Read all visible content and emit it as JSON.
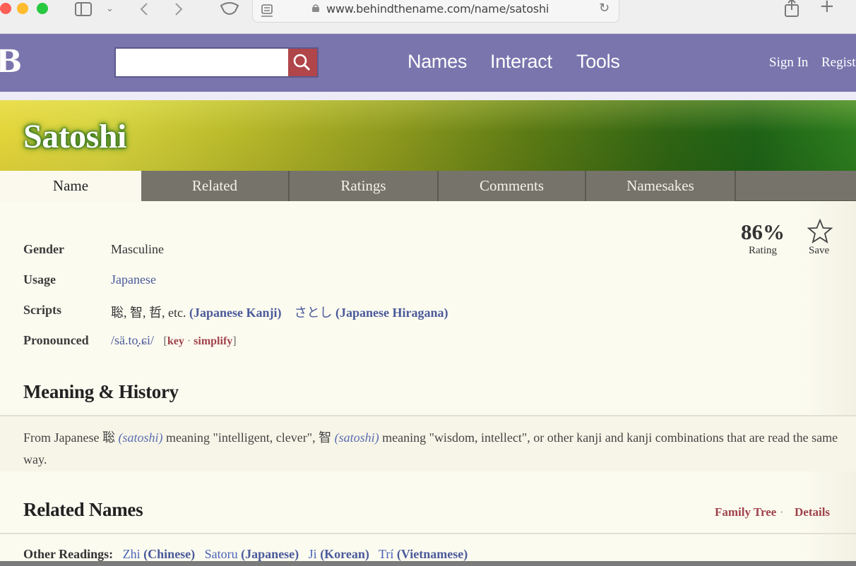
{
  "browser": {
    "url": "www.behindthename.com/name/satoshi"
  },
  "header": {
    "logo": "B",
    "search_placeholder": "",
    "nav": [
      "Names",
      "Interact",
      "Tools"
    ],
    "sign_in": "Sign In",
    "register": "Regist"
  },
  "page": {
    "title": "Satoshi",
    "tabs": [
      "Name",
      "Related",
      "Ratings",
      "Comments",
      "Namesakes"
    ],
    "active_tab": "Name"
  },
  "info": {
    "gender_label": "Gender",
    "gender_value": "Masculine",
    "usage_label": "Usage",
    "usage_value": "Japanese",
    "scripts_label": "Scripts",
    "scripts_kanji": "聡, 智, 哲, etc.",
    "scripts_kanji_link": "(Japanese Kanji)",
    "scripts_hiragana": "さとし",
    "scripts_hiragana_link": "(Japanese Hiragana)",
    "pronounced_label": "Pronounced",
    "pronounced_value": "/sä.to̞.ɕi/",
    "pronounced_open": "[",
    "pronounced_key": "key",
    "pronounced_sep": " · ",
    "pronounced_simplify": "simplify",
    "pronounced_close": "]"
  },
  "rating": {
    "percent": "86%",
    "label": "Rating",
    "save_label": "Save"
  },
  "meaning": {
    "heading": "Meaning & History",
    "text_1": "From Japanese 聡 ",
    "link_1": "(satoshi)",
    "text_2": " meaning \"intelligent, clever\", 智 ",
    "link_2": "(satoshi)",
    "text_3": " meaning \"wisdom, intellect\", or other kanji and kanji combinations that are read the same way."
  },
  "related": {
    "heading": "Related Names",
    "family_tree": "Family Tree",
    "sep": " · ",
    "details": "Details",
    "other_readings_label": "Other Readings:",
    "readings": [
      {
        "name": "Zhi",
        "lang": "(Chinese)"
      },
      {
        "name": "Satoru",
        "lang": "(Japanese)"
      },
      {
        "name": "Ji",
        "lang": "(Korean)"
      },
      {
        "name": "Trí",
        "lang": "(Vietnamese)"
      }
    ]
  },
  "colors": {
    "header": "#7a75ad",
    "search_button": "#b0454a",
    "tab_bar": "#76746a",
    "link_blue": "#4a63b8",
    "link_red": "#a0424a"
  }
}
